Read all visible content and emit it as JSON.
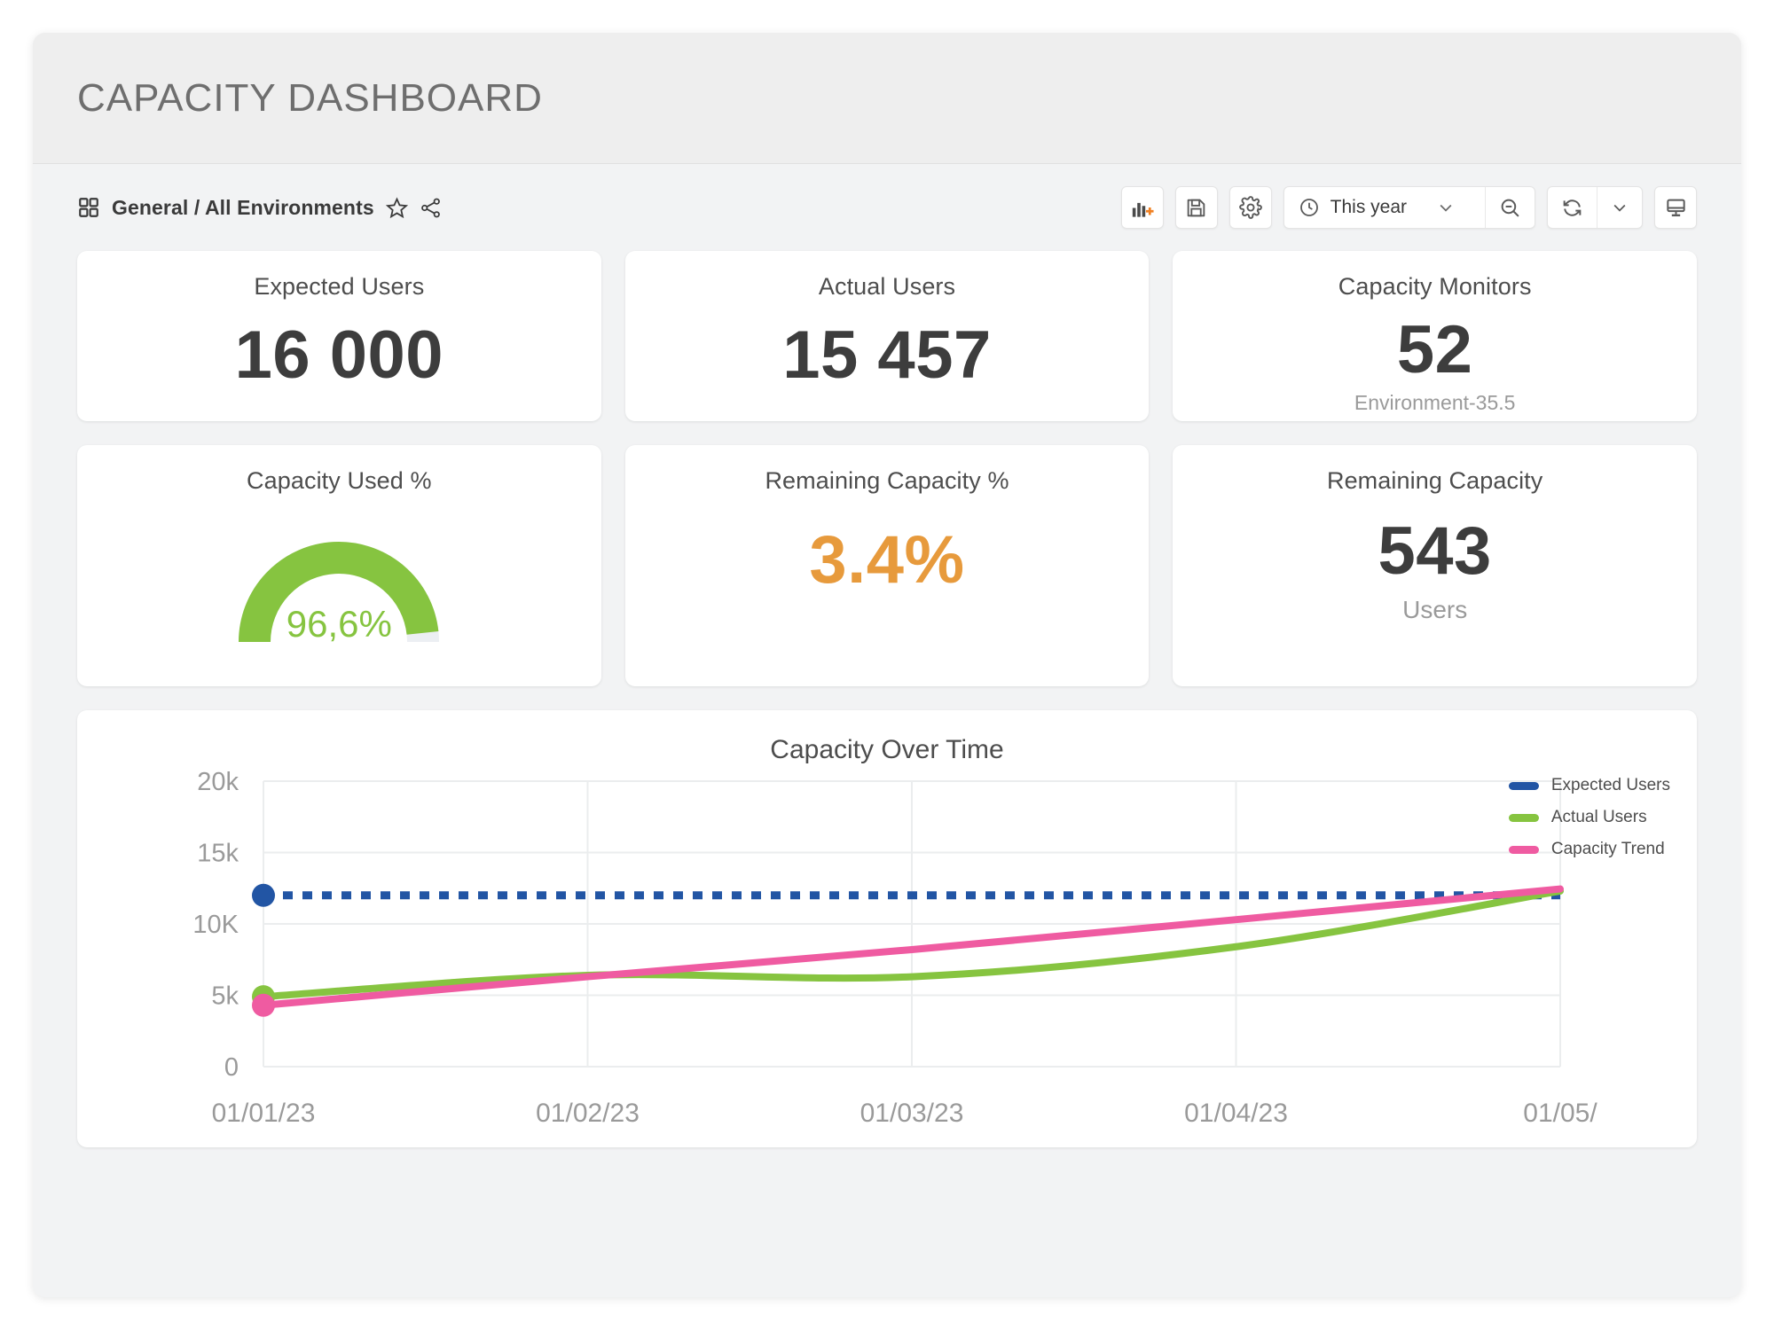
{
  "header": {
    "title": "CAPACITY DASHBOARD"
  },
  "toolbar": {
    "breadcrumb": "General / All Environments",
    "grid_icon": "grid-icon",
    "favorite_icon": "star-icon",
    "share_icon": "share-icon",
    "add_panel_label": "add-panel-icon",
    "save_label": "save-icon",
    "settings_label": "settings-gear-icon",
    "time_range": "This year",
    "zoom_out_label": "zoom-out-icon",
    "refresh_label": "refresh-icon",
    "refresh_interval_label": "chevron-down-icon",
    "tv_mode_label": "tv-display-icon"
  },
  "kpis": [
    {
      "title": "Expected Users",
      "value": "16 000",
      "sub": ""
    },
    {
      "title": "Actual Users",
      "value": "15 457",
      "sub": ""
    },
    {
      "title": "Capacity Monitors",
      "value": "52",
      "sub": "Environment-35.5"
    }
  ],
  "kpis2": [
    {
      "title": "Capacity Used %",
      "gauge_value": "96,6%",
      "gauge_percent": 96.6
    },
    {
      "title": "Remaining Capacity %",
      "value": "3.4%",
      "sub": ""
    },
    {
      "title": "Remaining Capacity",
      "value": "543",
      "sub": "Users"
    }
  ],
  "colors": {
    "green": "#86c440",
    "orange": "#e79a3c",
    "blue": "#2255a4",
    "pink": "#ef5ba1",
    "gauge_track": "#eceff3",
    "grid": "#ebedee",
    "axis_text": "#9a9a9a"
  },
  "chart_data": {
    "type": "line",
    "title": "Capacity Over Time",
    "xlabel": "",
    "ylabel": "",
    "grid": true,
    "legend_position": "right",
    "ylim": [
      0,
      20000
    ],
    "ytick_labels": [
      "20k",
      "15k",
      "10K",
      "5k",
      "0"
    ],
    "ytick_values": [
      20000,
      15000,
      10000,
      5000,
      0
    ],
    "xtick_labels": [
      "01/01/23",
      "01/02/23",
      "01/03/23",
      "01/04/23",
      "01/05/"
    ],
    "x": [
      "01/01/23",
      "01/02/23",
      "01/03/23",
      "01/04/23",
      "01/05/23"
    ],
    "series": [
      {
        "name": "Expected Users",
        "color": "#2255a4",
        "style": "dotted",
        "marker_at_start": true,
        "values": [
          12000,
          12000,
          12000,
          12000,
          12000
        ]
      },
      {
        "name": "Actual Users",
        "color": "#86c440",
        "style": "solid",
        "marker_at_start": true,
        "values": [
          4900,
          6400,
          6300,
          8400,
          12300
        ]
      },
      {
        "name": "Capacity Trend",
        "color": "#ef5ba1",
        "style": "solid",
        "marker_at_start": true,
        "values": [
          4300,
          6300,
          8200,
          10300,
          12450
        ]
      }
    ]
  }
}
